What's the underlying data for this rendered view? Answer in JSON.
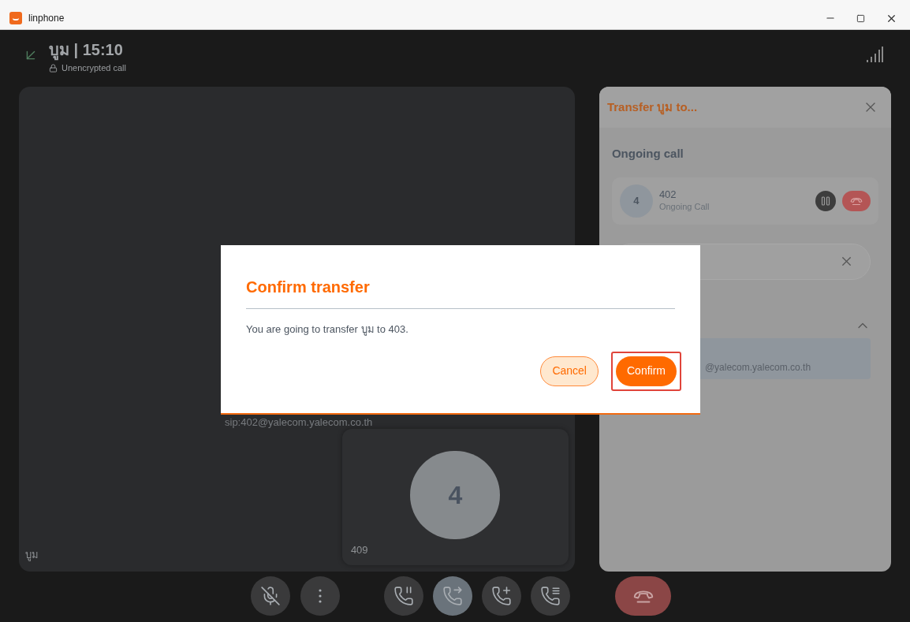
{
  "window": {
    "title": "linphone"
  },
  "call_header": {
    "title": "บูม | 15:10",
    "encryption": "Unencrypted call"
  },
  "main_video": {
    "caller_label": "บูม",
    "sip_address": "sip:402@yalecom.yalecom.co.th",
    "tile": {
      "initial": "4",
      "label": "409"
    }
  },
  "transfer_panel": {
    "title": "Transfer บูม to...",
    "section": "Ongoing call",
    "call": {
      "initial": "4",
      "number": "402",
      "status": "Ongoing Call"
    },
    "list_expanded": true,
    "contact_address": "@yalecom.yalecom.co.th"
  },
  "controls": [
    {
      "kind": "mute",
      "selected": false
    },
    {
      "kind": "more",
      "selected": false
    },
    {
      "kind": "pause",
      "selected": false
    },
    {
      "kind": "transfer",
      "selected": true
    },
    {
      "kind": "add",
      "selected": false
    },
    {
      "kind": "list",
      "selected": false
    },
    {
      "kind": "hangup",
      "selected": false
    }
  ],
  "dialog": {
    "title": "Confirm transfer",
    "message": "You are going to transfer บูม to 403.",
    "buttons": [
      {
        "label": "Cancel",
        "kind": "secondary",
        "focused": false
      },
      {
        "label": "Confirm",
        "kind": "primary",
        "focused": true
      }
    ]
  }
}
